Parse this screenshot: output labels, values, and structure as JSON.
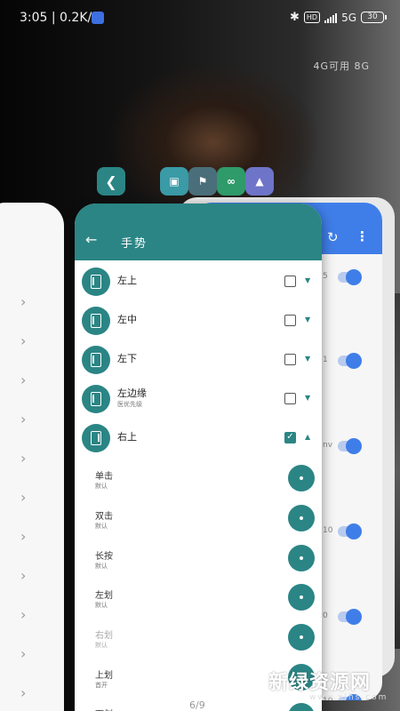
{
  "status_bar": {
    "time": "3:05 | 0.2K/s",
    "hd": "HD",
    "network": "5G",
    "battery": "30"
  },
  "memory_info": "4G可用  8G",
  "front_card": {
    "title": "手势",
    "gestures": [
      {
        "label": "左上",
        "sub": "",
        "checked": false
      },
      {
        "label": "左中",
        "sub": "",
        "checked": false
      },
      {
        "label": "左下",
        "sub": "",
        "checked": false
      },
      {
        "label": "左边缘",
        "sub": "医优先级",
        "checked": false
      },
      {
        "label": "右上",
        "sub": "",
        "checked": true
      }
    ],
    "actions": [
      {
        "label": "单击",
        "sub": "默认"
      },
      {
        "label": "双击",
        "sub": "默认"
      },
      {
        "label": "长按",
        "sub": "默认"
      },
      {
        "label": "左划",
        "sub": "默认"
      },
      {
        "label": "右划",
        "sub": "默认"
      },
      {
        "label": "上划",
        "sub": "首开"
      },
      {
        "label": "下划",
        "sub": ""
      }
    ]
  },
  "back_card": {
    "fragments": [
      "5",
      "1",
      "nv",
      "10",
      "0",
      "10"
    ]
  },
  "page_indicator": "6/9",
  "watermark": {
    "text": "新绿资源网",
    "sub": "www.xlhs.com"
  },
  "colors": {
    "teal": "#2b8585",
    "blue": "#3f7ee8"
  }
}
